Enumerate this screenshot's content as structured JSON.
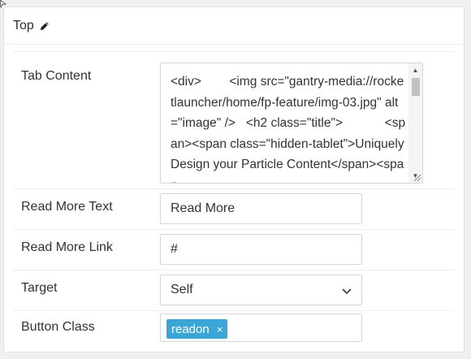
{
  "panel": {
    "title": "Top",
    "icon": "pencil-icon"
  },
  "fields": {
    "tab_content": {
      "label": "Tab Content",
      "value": "<div>        <img src=\"gantry-media://rocketlauncher/home/fp-feature/img-03.jpg\" alt=\"image\" />   <h2 class=\"title\">            <span><span class=\"hidden-tablet\">Uniquely Design your Particle Content</span><span"
    },
    "read_more_text": {
      "label": "Read More Text",
      "value": "Read More"
    },
    "read_more_link": {
      "label": "Read More Link",
      "value": "#"
    },
    "target": {
      "label": "Target",
      "value": "Self"
    },
    "button_class": {
      "label": "Button Class",
      "tags": [
        "readon"
      ],
      "remove_glyph": "×"
    }
  },
  "colors": {
    "tag_bg": "#3aa6d6",
    "border": "#d5d5d5"
  }
}
